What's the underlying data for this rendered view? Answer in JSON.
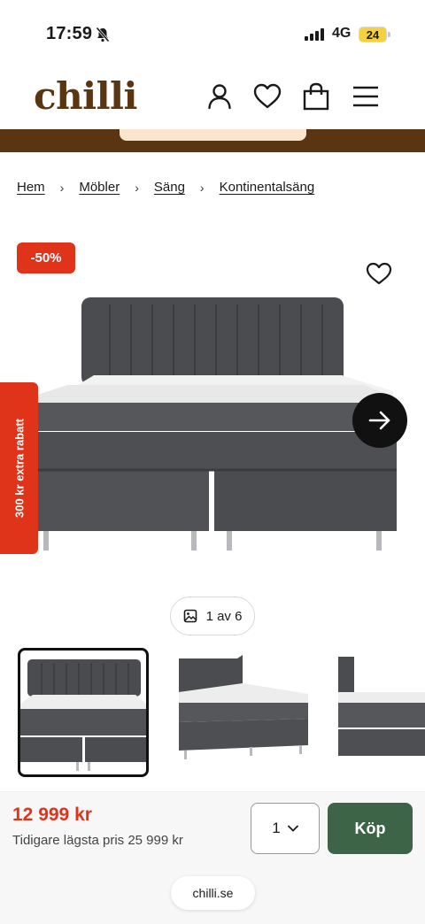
{
  "status_bar": {
    "time": "17:59",
    "network": "4G",
    "battery": "24"
  },
  "header": {
    "logo": "chilli",
    "icons": [
      "user-icon",
      "heart-icon",
      "bag-icon",
      "menu-icon"
    ]
  },
  "breadcrumb": [
    "Hem",
    "Möbler",
    "Säng",
    "Kontinentalsäng"
  ],
  "product": {
    "discount_badge": "-50%",
    "side_tab": "300 kr extra rabatt",
    "image_counter": "1 av 6",
    "price": "12 999 kr",
    "previous_price": "Tidigare lägsta pris 25 999 kr",
    "quantity": "1",
    "buy_label": "Köp"
  },
  "browser": {
    "url": "chilli.se"
  },
  "colors": {
    "brand_brown": "#5a3512",
    "accent_red": "#e0341a",
    "buy_green": "#3e6448"
  }
}
